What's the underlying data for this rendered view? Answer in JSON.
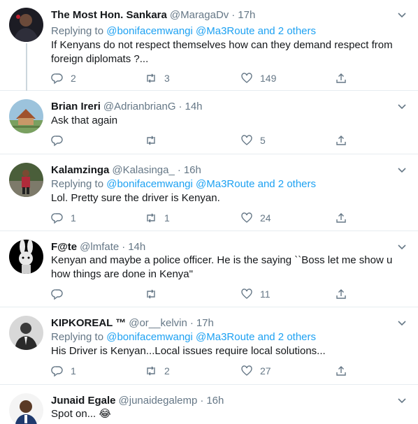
{
  "replying_prefix": "Replying to ",
  "tweets": [
    {
      "name": "The Most Hon. Sankara",
      "handle": "@MaragaDv",
      "time": "17h",
      "replying_to": "@bonifacemwangi @Ma3Route and 2 others",
      "text_lines": [
        "If Kenyans do not respect themselves how can they demand respect from",
        "foreign diplomats ?..."
      ],
      "replies": "2",
      "retweets": "3",
      "likes": "149"
    },
    {
      "name": "Brian Ireri",
      "handle": "@AdrianbrianG",
      "time": "14h",
      "replying_to": "",
      "text_lines": [
        "Ask that again"
      ],
      "replies": "",
      "retweets": "",
      "likes": "5"
    },
    {
      "name": "Kalamzinga",
      "handle": "@Kalasinga_",
      "time": "16h",
      "replying_to": "@bonifacemwangi @Ma3Route and 2 others",
      "text_lines": [
        "Lol. Pretty sure the driver is Kenyan."
      ],
      "replies": "1",
      "retweets": "1",
      "likes": "24"
    },
    {
      "name": "F@te",
      "handle": "@lmfate",
      "time": "14h",
      "replying_to": "",
      "text_lines": [
        "Kenyan and maybe a police officer. He is the saying ``Boss let me show u",
        "how things are done in Kenya\""
      ],
      "replies": "",
      "retweets": "",
      "likes": "11"
    },
    {
      "name": "KIPKOREAL ™",
      "handle": "@or__kelvin",
      "time": "17h",
      "replying_to": "@bonifacemwangi @Ma3Route and 2 others",
      "text_lines": [
        "His Driver is Kenyan...Local issues require local solutions..."
      ],
      "replies": "1",
      "retweets": "2",
      "likes": "27"
    },
    {
      "name": "Junaid Egale",
      "handle": "@junaidegalemp",
      "time": "16h",
      "replying_to": "",
      "text_lines": [
        "Spot on... 😂"
      ],
      "replies": "",
      "retweets": "",
      "likes": ""
    }
  ],
  "colors": {
    "text": "#14171a",
    "secondary": "#657786",
    "link": "#1da1f2",
    "divider": "#e6ecf0"
  },
  "icons": [
    "reply-icon",
    "retweet-icon",
    "like-icon",
    "share-icon",
    "chevron-down-icon"
  ]
}
